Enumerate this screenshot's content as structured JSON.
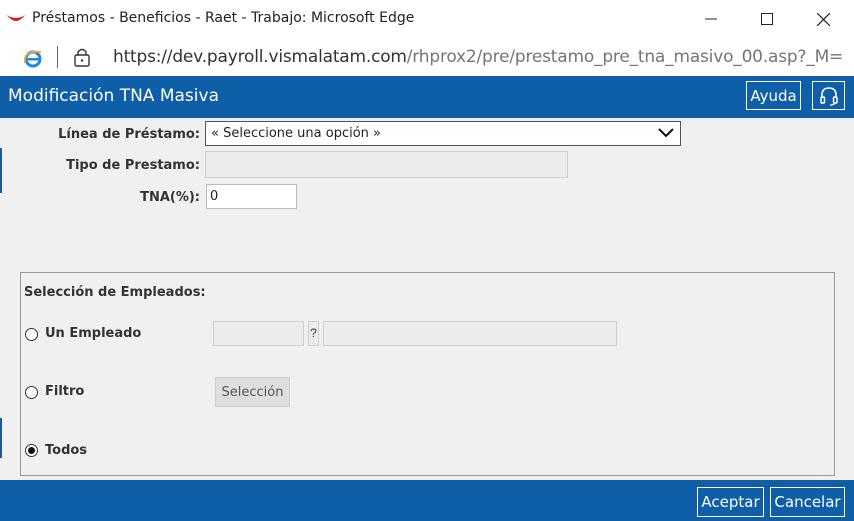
{
  "window": {
    "title": "Préstamos - Beneficios - Raet - Trabajo: Microsoft Edge",
    "url_host": "https://dev.payroll.vismalatam.com",
    "url_path": "/rhprox2/pre/prestamo_pre_tna_masivo_00.asp?_M="
  },
  "header": {
    "title": "Modificación TNA Masiva",
    "help_label": "Ayuda"
  },
  "form": {
    "linea_label": "Línea de Préstamo:",
    "linea_value": "« Seleccione una opción »",
    "tipo_label": "Tipo de Prestamo:",
    "tipo_value": "",
    "tna_label": "TNA(%):",
    "tna_value": "0"
  },
  "employees": {
    "legend": "Selección de Empleados:",
    "options": [
      {
        "label": "Un Empleado",
        "checked": false
      },
      {
        "label": "Filtro",
        "checked": false
      },
      {
        "label": "Todos",
        "checked": true
      }
    ],
    "lookup_button": "?",
    "selection_button": "Selección"
  },
  "footer": {
    "accept_label": "Aceptar",
    "cancel_label": "Cancelar"
  },
  "colors": {
    "brand": "#0e5fa7"
  }
}
